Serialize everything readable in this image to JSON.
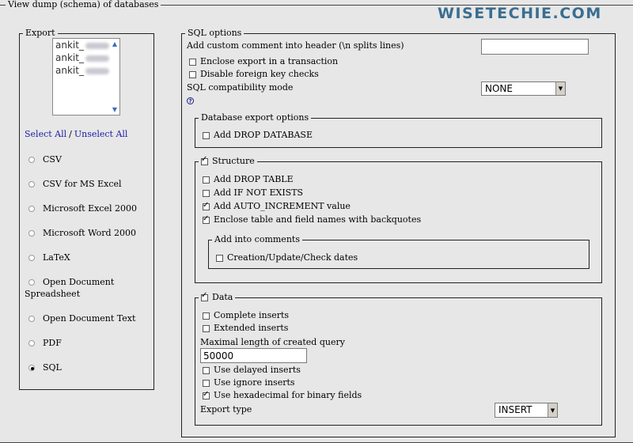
{
  "outer_legend": "View dump (schema) of databases",
  "brand": "WISETECHIE.COM",
  "export": {
    "legend": "Export",
    "db_list": [
      {
        "prefix": "ankit_"
      },
      {
        "prefix": "ankit_"
      },
      {
        "prefix": "ankit_"
      }
    ],
    "select_all": "Select All",
    "separator": "/",
    "unselect_all": "Unselect All",
    "formats": [
      {
        "label": "CSV",
        "checked": false
      },
      {
        "label": "CSV for MS Excel",
        "checked": false
      },
      {
        "label": "Microsoft Excel 2000",
        "checked": false
      },
      {
        "label": "Microsoft Word 2000",
        "checked": false
      },
      {
        "label": "LaTeX",
        "checked": false
      },
      {
        "label": "Open Document",
        "label2": "Spreadsheet",
        "checked": false
      },
      {
        "label": "Open Document Text",
        "checked": false
      },
      {
        "label": "PDF",
        "checked": false
      },
      {
        "label": "SQL",
        "checked": true
      }
    ]
  },
  "sql": {
    "legend": "SQL options",
    "comment_label": "Add custom comment into header (\\n splits lines)",
    "comment_value": "",
    "enclose_transaction": "Enclose export in a transaction",
    "disable_fk": "Disable foreign key checks",
    "compat_label": "SQL compatibility mode",
    "compat_value": "NONE",
    "db_options": {
      "legend": "Database export options",
      "drop_database": "Add DROP DATABASE"
    },
    "structure": {
      "legend": "Structure",
      "drop_table": "Add DROP TABLE",
      "if_not_exists": "Add IF NOT EXISTS",
      "auto_increment": "Add AUTO_INCREMENT value",
      "backquotes": "Enclose table and field names with backquotes",
      "comments": {
        "legend": "Add into comments",
        "dates": "Creation/Update/Check dates"
      }
    },
    "data": {
      "legend": "Data",
      "complete_inserts": "Complete inserts",
      "extended_inserts": "Extended inserts",
      "max_length_label": "Maximal length of created query",
      "max_length_value": "50000",
      "delayed_inserts": "Use delayed inserts",
      "ignore_inserts": "Use ignore inserts",
      "hexadecimal": "Use hexadecimal for binary fields",
      "export_type_label": "Export type",
      "export_type_value": "INSERT"
    }
  }
}
